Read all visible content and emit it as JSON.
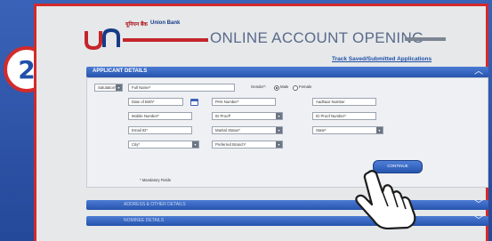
{
  "step": {
    "number": "2"
  },
  "brand": {
    "hindi": "यूनियन बैंक",
    "english": "Union Bank"
  },
  "header": {
    "title": "ONLINE ACCOUNT OPENING"
  },
  "track_link": "Track Saved/Submitted Applications",
  "applicant_section": {
    "title": "APPLICANT DETAILS"
  },
  "form": {
    "salutation": "Salutation*",
    "full_name": "Full Name*",
    "gender_label": "Gender*:",
    "male": "Male",
    "female": "Female",
    "dob": "Date of Birth*",
    "pan": "PAN Number*",
    "aadhaar": "Aadhaar Number",
    "mobile": "Mobile Number*",
    "id_proof": "ID Proof*",
    "id_proof_number": "ID Proof Number*",
    "email": "Email ID*",
    "marital_status": "Marital Status*",
    "state": "State*",
    "city": "City*",
    "preferred_branch": "Preferred Branch*",
    "mandatory_note": "* Mandatory Fields",
    "continue": "CONTINUE"
  },
  "collapsed_sections": [
    {
      "title": "ADDRESS & OTHER DETAILS"
    },
    {
      "title": "NOMINEE DETAILS"
    }
  ],
  "colors": {
    "accent": "#2553ad",
    "border_red": "#d42a2a"
  }
}
